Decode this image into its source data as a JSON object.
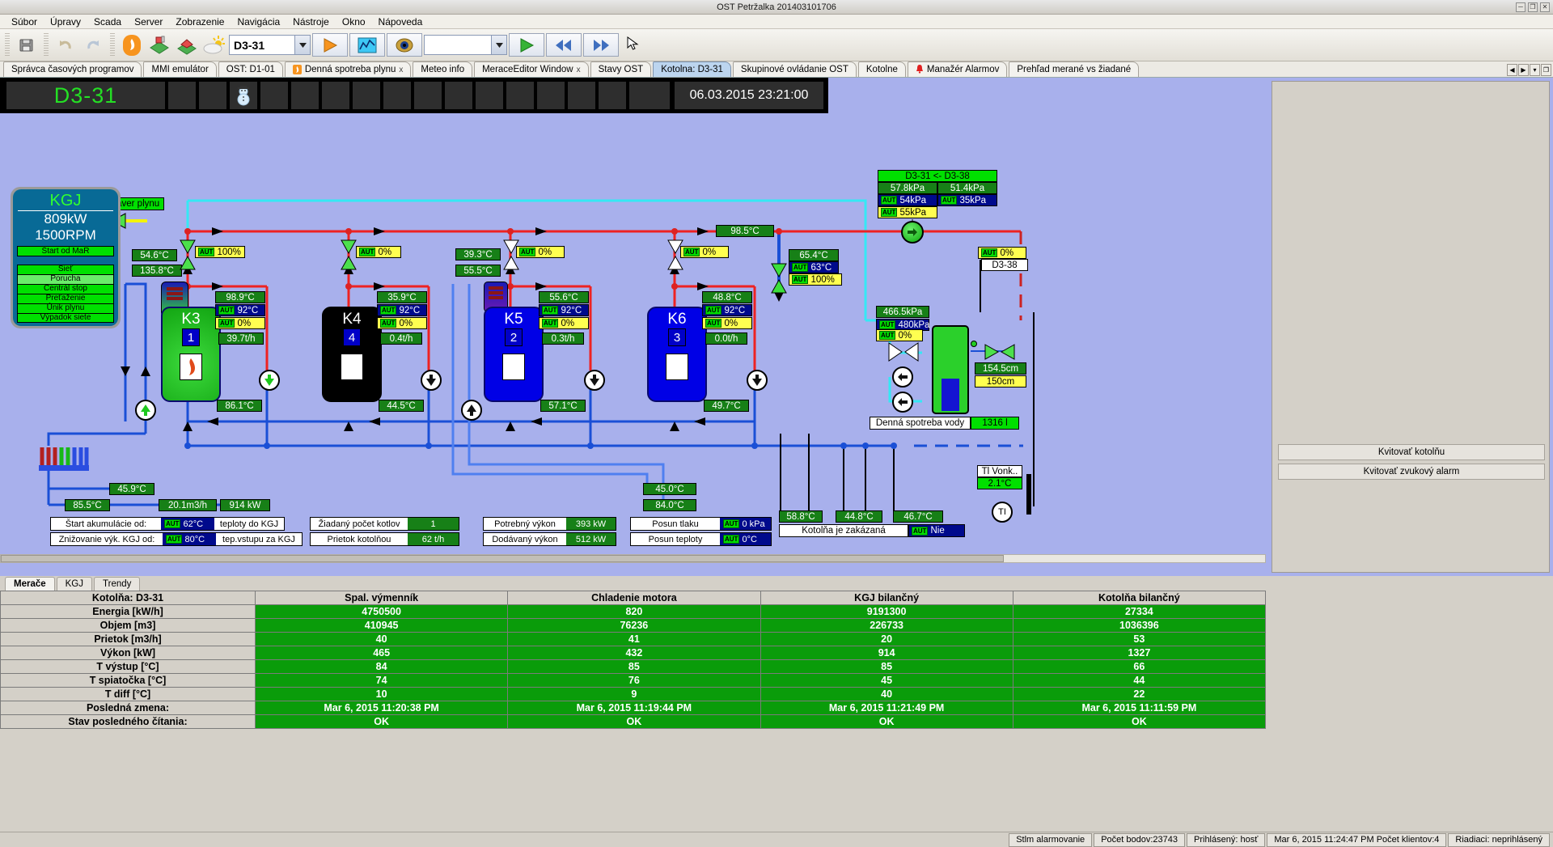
{
  "window": {
    "title": "OST Petržalka 201403101706",
    "min": "─",
    "max": "❐",
    "close": "✕"
  },
  "menu": [
    "Súbor",
    "Úpravy",
    "Scada",
    "Server",
    "Zobrazenie",
    "Navigácia",
    "Nástroje",
    "Okno",
    "Nápoveda"
  ],
  "toolbar": {
    "combo_value": "D3-31",
    "combo2_value": "",
    "icons": [
      "save-icon",
      "undo-icon",
      "redo-icon",
      "flame-icon",
      "boiler-house-icon",
      "house-icon",
      "weather-icon",
      "play-icon",
      "trend-icon",
      "eye-icon",
      "play2-icon",
      "first-icon",
      "last-icon"
    ]
  },
  "tabs": [
    {
      "label": "Správca časových programov",
      "active": false,
      "closable": false,
      "icon": null
    },
    {
      "label": "MMI emulátor",
      "active": false,
      "closable": false,
      "icon": null
    },
    {
      "label": "OST: D1-01",
      "active": false,
      "closable": false,
      "icon": null
    },
    {
      "label": "Denná spotreba plynu",
      "active": false,
      "closable": true,
      "icon": "flame-icon"
    },
    {
      "label": "Meteo info",
      "active": false,
      "closable": false,
      "icon": null
    },
    {
      "label": "MeraceEditor Window",
      "active": false,
      "closable": true,
      "icon": null
    },
    {
      "label": "Stavy OST",
      "active": false,
      "closable": false,
      "icon": null
    },
    {
      "label": "Kotolna: D3-31",
      "active": true,
      "closable": false,
      "icon": null
    },
    {
      "label": "Skupinové ovládanie OST",
      "active": false,
      "closable": false,
      "icon": null
    },
    {
      "label": "Kotolne",
      "active": false,
      "closable": false,
      "icon": null
    },
    {
      "label": "Manažér Alarmov",
      "active": false,
      "closable": false,
      "icon": "bell-icon"
    },
    {
      "label": "Prehľad merané vs žiadané",
      "active": false,
      "closable": false,
      "icon": null
    }
  ],
  "header": {
    "station": "D3-31",
    "datetime": "06.03.2015 23:21:00",
    "snowman": "snowman-icon"
  },
  "scada": {
    "gas_shutoff_label": "Havarijný uzáver plynu",
    "kgj": {
      "title": "KGJ",
      "power": "809kW",
      "rpm": "1500RPM",
      "start_bar": "Štart od MaR",
      "status": [
        "Sieť",
        "Porucha",
        "Centrál stop",
        "Preťaženie",
        "Únik plynu",
        "Výpadok siete"
      ]
    },
    "hx_in_temp": "54.6°C",
    "hx_out_temp": "135.8°C",
    "hx_valve": {
      "mode": "AUT",
      "value": "100%"
    },
    "boilers": [
      {
        "name": "K3",
        "num": "1",
        "color": "green",
        "out": "98.9°C",
        "set": "92°C",
        "valve": "0%",
        "flow": "39.7t/h",
        "ret": "86.1°C",
        "valve_top": "0%",
        "valve_mode": "AUT"
      },
      {
        "name": "K4",
        "num": "4",
        "color": "black",
        "out": "35.9°C",
        "set": "92°C",
        "valve": "0%",
        "flow": "0.4t/h",
        "ret": "44.5°C",
        "valve_top": "0%",
        "valve_mode": "AUT"
      },
      {
        "name": "K5",
        "num": "2",
        "color": "blue",
        "out": "55.6°C",
        "set": "92°C",
        "valve": "0%",
        "flow": "0.3t/h",
        "ret": "57.1°C",
        "valve_top": "0%",
        "valve_mode": "AUT"
      },
      {
        "name": "K6",
        "num": "3",
        "color": "blue",
        "out": "48.8°C",
        "set": "92°C",
        "valve": "0%",
        "flow": "0.0t/h",
        "ret": "49.7°C",
        "valve_top": "0%",
        "valve_mode": "AUT"
      }
    ],
    "k5_secondary": {
      "t1": "39.3°C",
      "t2": "55.5°C",
      "valve": "0%",
      "mode": "AUT"
    },
    "main_supply_temp": "98.5°C",
    "mix_valve": {
      "temp": "65.4°C",
      "set": "63°C",
      "pos": "100%",
      "mode": "AUT"
    },
    "d338": {
      "mode": "AUT",
      "value": "0%",
      "label": "D3-38"
    },
    "pressure_panel": {
      "title": "D3-31 <- D3-38",
      "p1": "57.8kPa",
      "p2": "51.4kPa",
      "sp1": "54kPa",
      "sp2": "35kPa",
      "sp3": "55kPa",
      "mode": "AUT"
    },
    "make_up": {
      "p_meas": "466.5kPa",
      "p_set": "480kPa",
      "pos": "0%",
      "mode": "AUT"
    },
    "tank": {
      "level_cm": "154.5cm",
      "level_set": "150cm"
    },
    "water_daily": {
      "label": "Denná spotreba vody",
      "value": "1316 l"
    },
    "low_temps": {
      "t_a": "45.9°C",
      "t_b": "85.5°C",
      "flow": "20.1m3/h",
      "power": "914 kW",
      "t_c": "45.0°C",
      "t_d": "84.0°C"
    },
    "right_temps": [
      "58.8°C",
      "44.8°C",
      "46.7°C"
    ],
    "boiler_disabled": {
      "label": "Kotolňa je zakázaná",
      "value": "Nie",
      "mode": "AUT"
    },
    "outside": {
      "label": "Tl Vonk..",
      "value": "2.1°C",
      "symbol": "TI"
    },
    "controls": [
      {
        "label": "Štart akumulácie od:",
        "value": "62°C",
        "mode": "AUT",
        "suffix": "teploty do KGJ",
        "vtype": "blue"
      },
      {
        "label": "Znižovanie výk. KGJ od:",
        "value": "80°C",
        "mode": "AUT",
        "suffix": "tep.vstupu za KGJ",
        "vtype": "blue"
      },
      {
        "label": "Žiadaný počet kotlov",
        "value": "1",
        "mode": null,
        "suffix": null,
        "vtype": "green"
      },
      {
        "label": "Prietok kotolňou",
        "value": "62 t/h",
        "mode": null,
        "suffix": null,
        "vtype": "green"
      },
      {
        "label": "Potrebný výkon",
        "value": "393 kW",
        "mode": null,
        "suffix": null,
        "vtype": "green"
      },
      {
        "label": "Dodávaný výkon",
        "value": "512 kW",
        "mode": null,
        "suffix": null,
        "vtype": "green"
      },
      {
        "label": "Posun tlaku",
        "value": "0 kPa",
        "mode": "AUT",
        "suffix": null,
        "vtype": "blue"
      },
      {
        "label": "Posun teploty",
        "value": "0°C",
        "mode": "AUT",
        "suffix": null,
        "vtype": "blue"
      }
    ]
  },
  "right_panel": {
    "btn1": "Kvitovať kotolňu",
    "btn2": "Kvitovať zvukový alarm"
  },
  "bottom_tabs": [
    {
      "label": "Merače",
      "active": true
    },
    {
      "label": "KGJ",
      "active": false
    },
    {
      "label": "Trendy",
      "active": false
    }
  ],
  "table": {
    "columns": [
      "Kotolňa: D3-31",
      "Spal. výmenník",
      "Chladenie motora",
      "KGJ bilančný",
      "Kotolňa bilančný"
    ],
    "rows": [
      {
        "label": "Energia [kW/h]",
        "values": [
          "4750500",
          "820",
          "9191300",
          "27334"
        ]
      },
      {
        "label": "Objem [m3]",
        "values": [
          "410945",
          "76236",
          "226733",
          "1036396"
        ]
      },
      {
        "label": "Prietok [m3/h]",
        "values": [
          "40",
          "41",
          "20",
          "53"
        ]
      },
      {
        "label": "Výkon [kW]",
        "values": [
          "465",
          "432",
          "914",
          "1327"
        ]
      },
      {
        "label": "T výstup [°C]",
        "values": [
          "84",
          "85",
          "85",
          "66"
        ]
      },
      {
        "label": "T spiatočka [°C]",
        "values": [
          "74",
          "76",
          "45",
          "44"
        ]
      },
      {
        "label": "T diff [°C]",
        "values": [
          "10",
          "9",
          "40",
          "22"
        ]
      },
      {
        "label": "Posledná zmena:",
        "values": [
          "Mar 6, 2015 11:20:38 PM",
          "Mar 6, 2015 11:19:44 PM",
          "Mar 6, 2015 11:21:49 PM",
          "Mar 6, 2015 11:11:59 PM"
        ]
      },
      {
        "label": "Stav posledného čítania:",
        "values": [
          "OK",
          "OK",
          "OK",
          "OK"
        ]
      }
    ]
  },
  "statusbar": [
    "Stlm alarmovanie",
    "Počet bodov:23743",
    "Prihlásený: hosť",
    "Mar 6, 2015 11:24:47 PM Počet klientov:4",
    "Riadiaci: neprihlásený"
  ]
}
